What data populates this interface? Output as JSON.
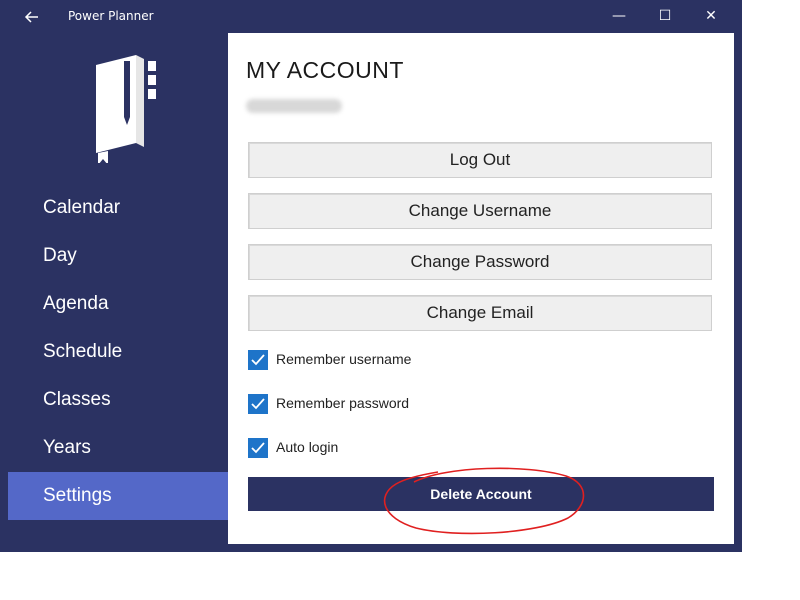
{
  "window": {
    "title": "Power Planner",
    "back_icon": "arrow-left-icon",
    "minimize_glyph": "—",
    "maximize_glyph": "☐",
    "close_glyph": "✕"
  },
  "sidebar": {
    "items": [
      {
        "label": "Calendar",
        "active": false
      },
      {
        "label": "Day",
        "active": false
      },
      {
        "label": "Agenda",
        "active": false
      },
      {
        "label": "Schedule",
        "active": false
      },
      {
        "label": "Classes",
        "active": false
      },
      {
        "label": "Years",
        "active": false
      },
      {
        "label": "Settings",
        "active": true
      }
    ]
  },
  "account": {
    "title": "MY ACCOUNT",
    "buttons": {
      "logout": "Log Out",
      "change_username": "Change Username",
      "change_password": "Change Password",
      "change_email": "Change Email"
    },
    "options": {
      "remember_username": {
        "label": "Remember username",
        "checked": true
      },
      "remember_password": {
        "label": "Remember password",
        "checked": true
      },
      "auto_login": {
        "label": "Auto login",
        "checked": true
      }
    },
    "delete_label": "Delete Account"
  },
  "colors": {
    "brand_navy": "#2b3262",
    "active_nav": "#5468c8",
    "checkbox_blue": "#1e74c9",
    "annotation_red": "#e02020"
  }
}
